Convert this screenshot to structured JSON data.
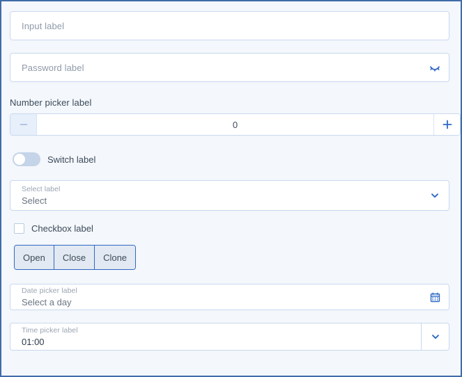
{
  "theme": {
    "page_border": "#3f6ba8",
    "page_background": "#f4f7fb",
    "field_border": "#c8d9ef",
    "accent_blue": "#2f68c4",
    "placeholder_text": "#8f9aa8",
    "label_text": "#3c4a5a"
  },
  "form": {
    "input": {
      "placeholder": "Input label",
      "value": ""
    },
    "password": {
      "placeholder": "Password label",
      "value": "",
      "toggle_icon": "eye-off-icon"
    },
    "number_picker": {
      "label": "Number picker label",
      "value": "0",
      "decrement_label": "−",
      "increment_label": "+",
      "decrement_icon": "minus-icon",
      "increment_icon": "plus-icon",
      "decrement_disabled": true
    },
    "switch": {
      "label": "Switch label",
      "checked": false
    },
    "select": {
      "label": "Select label",
      "value": "Select",
      "chevron_icon": "chevron-down-icon"
    },
    "checkbox": {
      "label": "Checkbox label",
      "checked": false
    },
    "button_group": {
      "buttons": [
        {
          "label": "Open"
        },
        {
          "label": "Close"
        },
        {
          "label": "Clone"
        }
      ]
    },
    "date_picker": {
      "label": "Date picker label",
      "value": "Select a day",
      "icon": "calendar-icon"
    },
    "time_picker": {
      "label": "Time picker label",
      "value": "01:00",
      "chevron_icon": "chevron-down-icon"
    }
  }
}
